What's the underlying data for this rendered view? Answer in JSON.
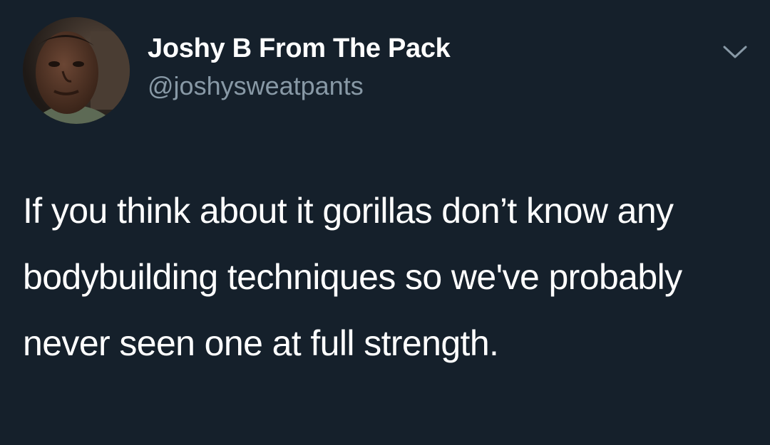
{
  "tweet": {
    "display_name": "Joshy B From The Pack",
    "handle": "@joshysweatpants",
    "text": "If you think about it gorillas don’t know any bodybuilding techniques so we've probably never seen one at full strength.",
    "avatar_icon": "user-avatar-photo",
    "menu_icon": "chevron-down-icon"
  },
  "colors": {
    "background": "#15202b",
    "primary_text": "#ffffff",
    "secondary_text": "#8899a6"
  }
}
